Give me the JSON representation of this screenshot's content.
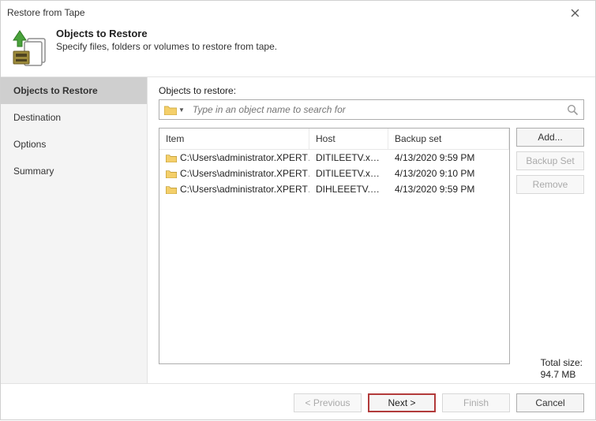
{
  "window": {
    "title": "Restore from Tape"
  },
  "header": {
    "title": "Objects to Restore",
    "subtitle": "Specify files, folders or volumes to restore from tape."
  },
  "sidebar": {
    "steps": [
      {
        "label": "Objects to Restore"
      },
      {
        "label": "Destination"
      },
      {
        "label": "Options"
      },
      {
        "label": "Summary"
      }
    ]
  },
  "section": {
    "label": "Objects to restore:"
  },
  "search": {
    "placeholder": "Type in an object name to search for"
  },
  "table": {
    "columns": {
      "item": "Item",
      "host": "Host",
      "set": "Backup set"
    },
    "rows": [
      {
        "item": "C:\\Users\\administrator.XPERT…",
        "host": "DITILEETV.xpert…",
        "set": "4/13/2020 9:59 PM"
      },
      {
        "item": "C:\\Users\\administrator.XPERT…",
        "host": "DITILEETV.xpert…",
        "set": "4/13/2020 9:10 PM"
      },
      {
        "item": "C:\\Users\\administrator.XPERT…",
        "host": "DIHLEEETV.xpert…",
        "set": "4/13/2020 9:59 PM"
      }
    ]
  },
  "actions": {
    "add": "Add...",
    "backup_set": "Backup Set",
    "remove": "Remove"
  },
  "totals": {
    "label": "Total size:",
    "value": "94.7 MB"
  },
  "wizard": {
    "previous": "< Previous",
    "next": "Next >",
    "finish": "Finish",
    "cancel": "Cancel"
  }
}
